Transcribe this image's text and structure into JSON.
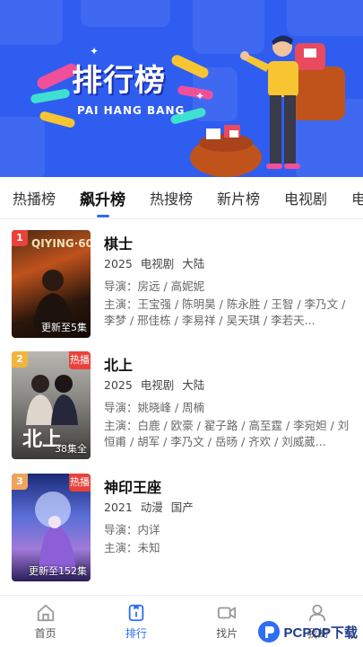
{
  "banner": {
    "title": "排行榜",
    "subtitle": "PAI HANG BANG"
  },
  "tabs": [
    {
      "label": "热播榜",
      "active": false
    },
    {
      "label": "飙升榜",
      "active": true
    },
    {
      "label": "热搜榜",
      "active": false
    },
    {
      "label": "新片榜",
      "active": false
    },
    {
      "label": "电视剧",
      "active": false
    },
    {
      "label": "电影",
      "active": false
    }
  ],
  "labels": {
    "director": "导演：",
    "cast": "主演："
  },
  "items": [
    {
      "rank": "1",
      "rank_color": "#e8423b",
      "title": "棋士",
      "year": "2025",
      "type": "电视剧",
      "region": "大陆",
      "director": "房远 / 高妮妮",
      "cast": "王宝强 / 陈明昊 / 陈永胜 / 王智 / 李乃文 / 李梦 / 邢佳栋 / 李易祥 / 吴天琪 / 李若天...",
      "episode": "更新至5集",
      "hot_badge": "",
      "poster_text": "QIYING·60"
    },
    {
      "rank": "2",
      "rank_color": "#f1b43c",
      "title": "北上",
      "year": "2025",
      "type": "电视剧",
      "region": "大陆",
      "director": "姚晓峰 / 周楠",
      "cast": "白鹿 / 欧豪 / 翟子路 / 高至霆 / 李宛妲 / 刘恒甫 / 胡军 / 李乃文 / 岳旸 / 齐欢 / 刘威葳...",
      "episode": "38集全",
      "hot_badge": "热播",
      "poster_text": "北上"
    },
    {
      "rank": "3",
      "rank_color": "#f0a35a",
      "title": "神印王座",
      "year": "2021",
      "type": "动漫",
      "region": "国产",
      "director": "内详",
      "cast": "未知",
      "episode": "更新至152集",
      "hot_badge": "热播",
      "poster_text": ""
    }
  ],
  "nav": [
    {
      "label": "首页",
      "icon": "home-icon",
      "active": false
    },
    {
      "label": "排行",
      "icon": "ranking-icon",
      "active": true
    },
    {
      "label": "找片",
      "icon": "video-icon",
      "active": false
    },
    {
      "label": "我的",
      "icon": "profile-icon",
      "active": false
    }
  ],
  "watermark": "PCPOP下载",
  "colors": {
    "accent": "#2f6df4",
    "banner_bg": "#2f5df0",
    "hot": "#e8423b"
  }
}
